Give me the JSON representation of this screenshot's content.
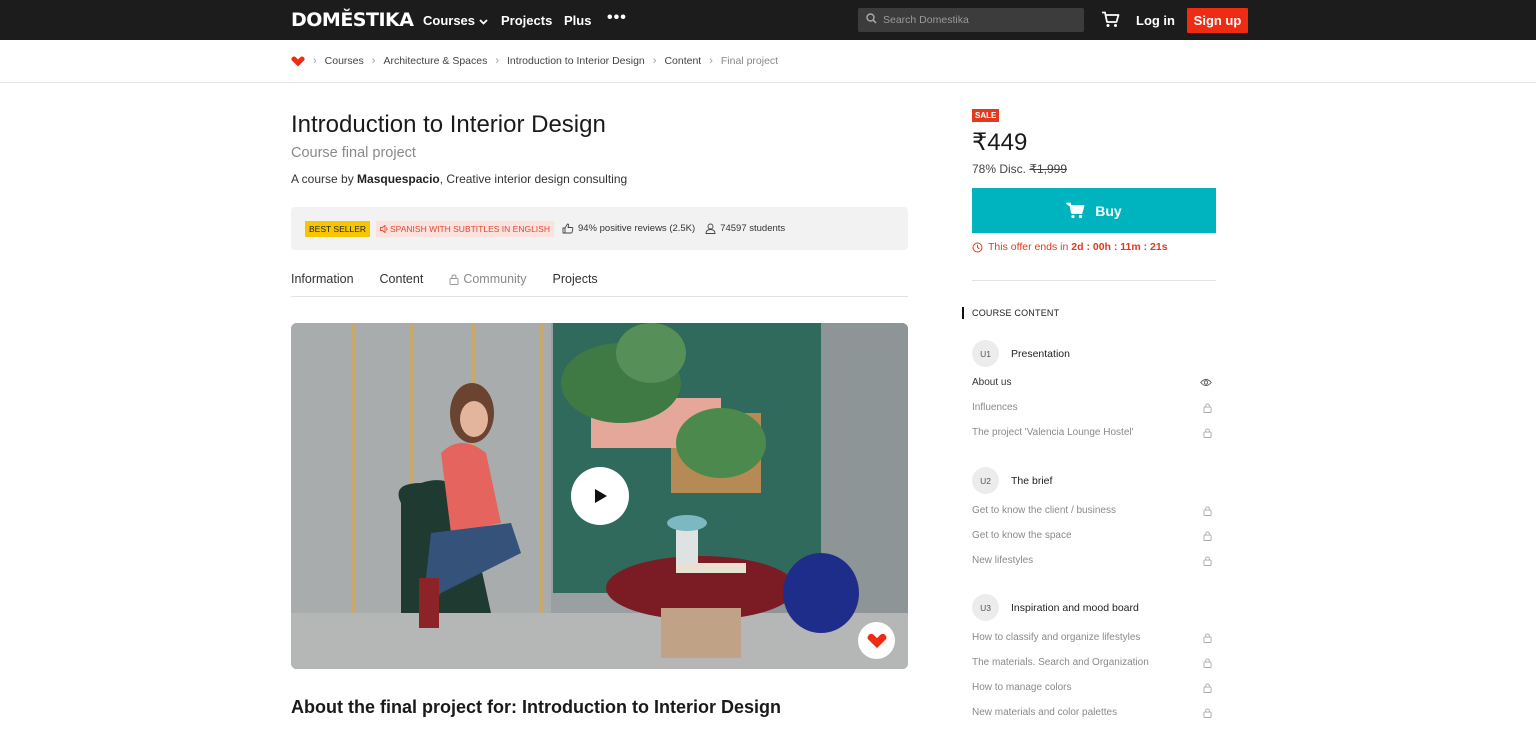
{
  "nav": {
    "logo": "DOMĔSTIKA",
    "courses": "Courses",
    "projects": "Projects",
    "plus": "Plus",
    "more": "•••",
    "search_placeholder": "Search Domestika",
    "login": "Log in",
    "signup": "Sign up"
  },
  "breadcrumb": [
    "Courses",
    "Architecture & Spaces",
    "Introduction to Interior Design",
    "Content",
    "Final project"
  ],
  "course": {
    "title": "Introduction to Interior Design",
    "subtitle": "Course final project",
    "by_prefix": "A course by ",
    "author": "Masquespacio",
    "author_suffix": ", Creative interior design consulting",
    "badge_best": "BEST SELLER",
    "badge_lang": "SPANISH WITH SUBTITLES IN ENGLISH",
    "reviews": "94% positive reviews (2.5K)",
    "students": "74597 students"
  },
  "tabs": [
    "Information",
    "Content",
    "Community",
    "Projects"
  ],
  "section_title": "About the final project for: Introduction to Interior Design",
  "purchase": {
    "sale": "SALE",
    "price": "₹449",
    "disc_prefix": "78% Disc. ",
    "old_price": "₹1,999",
    "buy": "Buy",
    "offer_prefix": "This offer ends in ",
    "offer_time": "2d : 00h : 11m : 21s"
  },
  "content": {
    "heading": "COURSE CONTENT",
    "units": [
      {
        "num": "U1",
        "title": "Presentation",
        "lessons": [
          {
            "title": "About us",
            "icon": "eye-icon"
          },
          {
            "title": "Influences",
            "icon": "lock-icon"
          },
          {
            "title": "The project 'Valencia Lounge Hostel'",
            "icon": "lock-icon"
          }
        ]
      },
      {
        "num": "U2",
        "title": "The brief",
        "lessons": [
          {
            "title": "Get to know the client / business",
            "icon": "lock-icon"
          },
          {
            "title": "Get to know the space",
            "icon": "lock-icon"
          },
          {
            "title": "New lifestyles",
            "icon": "lock-icon"
          }
        ]
      },
      {
        "num": "U3",
        "title": "Inspiration and mood board",
        "lessons": [
          {
            "title": "How to classify and organize lifestyles",
            "icon": "lock-icon"
          },
          {
            "title": "The materials. Search and Organization",
            "icon": "lock-icon"
          },
          {
            "title": "How to manage colors",
            "icon": "lock-icon"
          },
          {
            "title": "New materials and color palettes",
            "icon": "lock-icon"
          }
        ]
      }
    ]
  },
  "colors": {
    "accent": "#ee2b13",
    "buy": "#00b4bf",
    "nav_bg": "#1c1c1c"
  }
}
